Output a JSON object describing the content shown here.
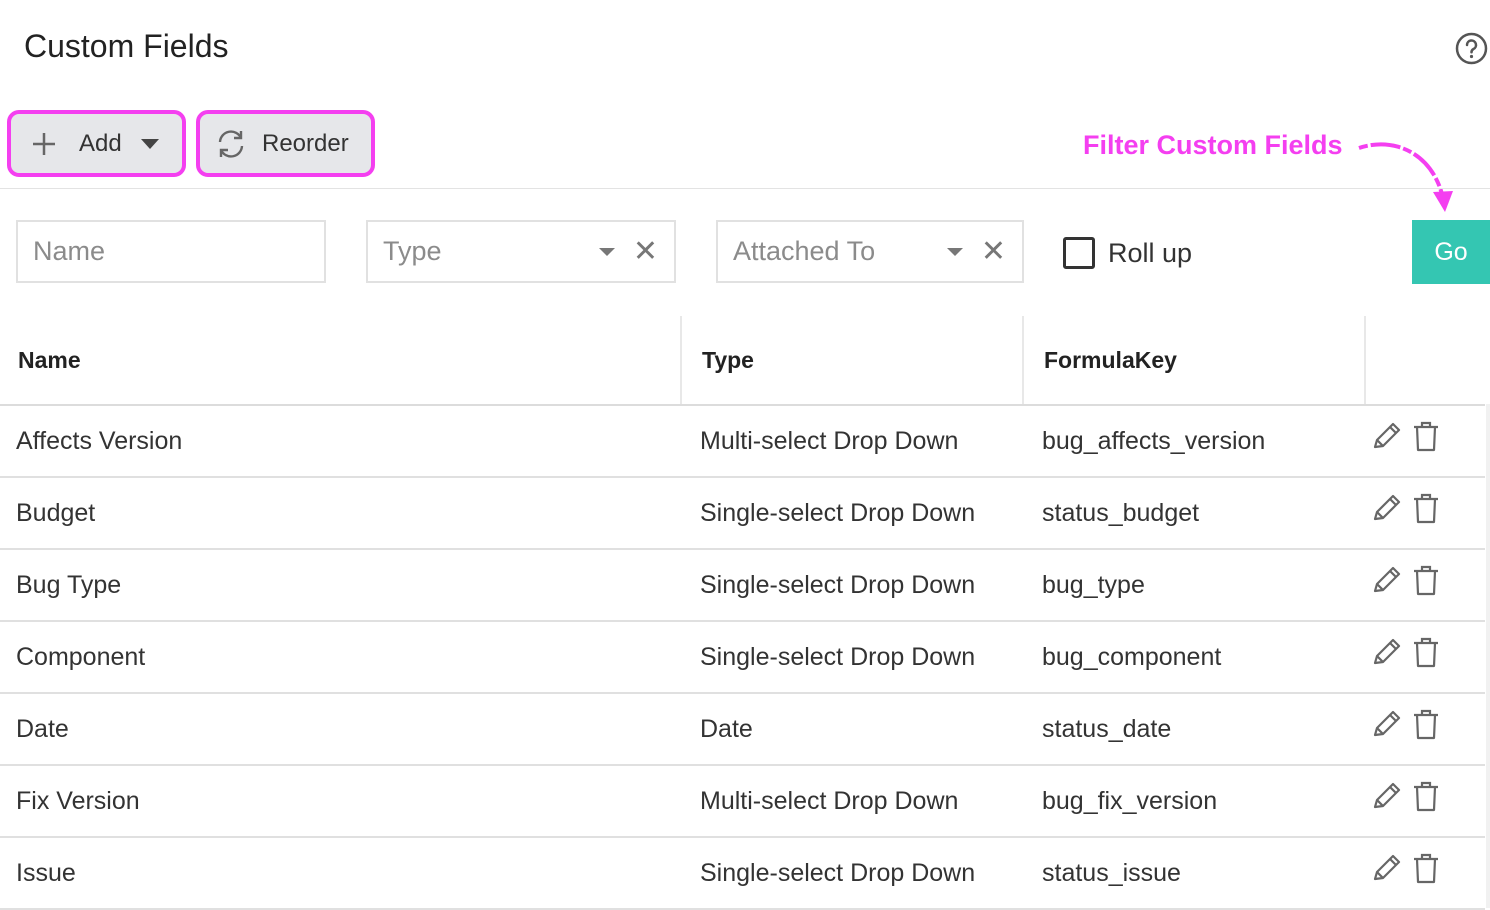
{
  "page": {
    "title": "Custom Fields"
  },
  "toolbar": {
    "add_label": "Add",
    "reorder_label": "Reorder"
  },
  "annotation": {
    "text": "Filter Custom Fields",
    "color": "#f43ff0"
  },
  "filters": {
    "name_placeholder": "Name",
    "type_placeholder": "Type",
    "attached_to_placeholder": "Attached To",
    "rollup_label": "Roll up",
    "rollup_checked": false,
    "go_label": "Go"
  },
  "table": {
    "columns": [
      "Name",
      "Type",
      "FormulaKey",
      ""
    ],
    "rows": [
      {
        "name": "Affects Version",
        "type": "Multi-select Drop Down",
        "formula_key": "bug_affects_version"
      },
      {
        "name": "Budget",
        "type": "Single-select Drop Down",
        "formula_key": "status_budget"
      },
      {
        "name": "Bug Type",
        "type": "Single-select Drop Down",
        "formula_key": "bug_type"
      },
      {
        "name": "Component",
        "type": "Single-select Drop Down",
        "formula_key": "bug_component"
      },
      {
        "name": "Date",
        "type": "Date",
        "formula_key": "status_date"
      },
      {
        "name": "Fix Version",
        "type": "Multi-select Drop Down",
        "formula_key": "bug_fix_version"
      },
      {
        "name": "Issue",
        "type": "Single-select Drop Down",
        "formula_key": "status_issue"
      }
    ]
  },
  "colors": {
    "accent": "#34c6b2",
    "highlight": "#f43ff0",
    "button_bg": "#e6e7ea"
  },
  "icons": {
    "help": "help-circle-icon",
    "add": "plus-icon",
    "reorder": "refresh-icon",
    "edit": "pencil-icon",
    "delete": "trash-icon"
  }
}
